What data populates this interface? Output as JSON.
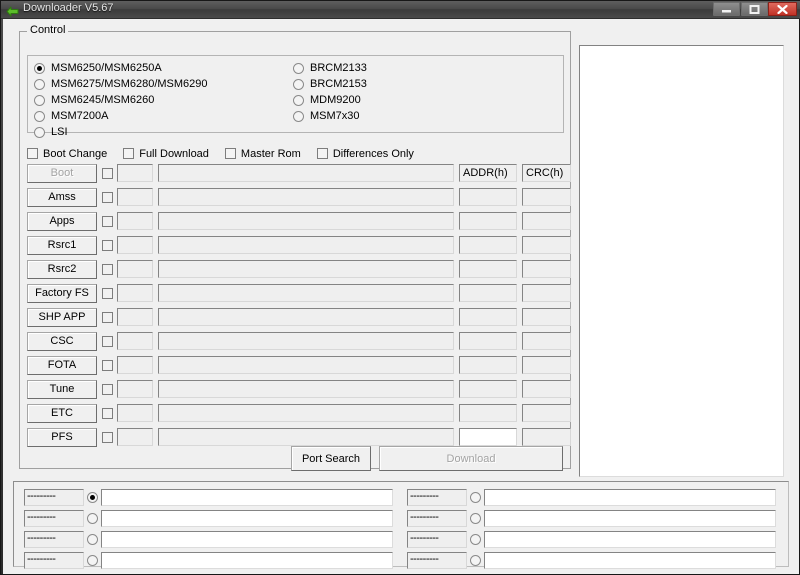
{
  "window": {
    "title": "Downloader V5.67",
    "icon": "green-left-arrow-icon",
    "minimize_label": "–",
    "maximize_label": "□",
    "close_label": "✕",
    "accent_close": "#c03226",
    "face_color": "#f0f0f0"
  },
  "control_group": {
    "legend": "Control",
    "chips": {
      "left": [
        {
          "label": "MSM6250/MSM6250A",
          "selected": true
        },
        {
          "label": "MSM6275/MSM6280/MSM6290",
          "selected": false
        },
        {
          "label": "MSM6245/MSM6260",
          "selected": false
        },
        {
          "label": "MSM7200A",
          "selected": false
        },
        {
          "label": "LSI",
          "selected": false
        }
      ],
      "right": [
        {
          "label": "BRCM2133",
          "selected": false
        },
        {
          "label": "BRCM2153",
          "selected": false
        },
        {
          "label": "MDM9200",
          "selected": false
        },
        {
          "label": "MSM7x30",
          "selected": false
        }
      ]
    },
    "options": [
      {
        "label": "Boot Change",
        "checked": false
      },
      {
        "label": "Full Download",
        "checked": false
      },
      {
        "label": "Master Rom",
        "checked": false
      },
      {
        "label": "Differences Only",
        "checked": false
      }
    ],
    "column_headers": {
      "addr": "ADDR(h)",
      "crc": "CRC(h)"
    },
    "rows": [
      {
        "button": "Boot",
        "enabled": false,
        "checked": false,
        "size": "",
        "path": "",
        "addr": "ADDR(h)",
        "crc": "CRC(h)",
        "addr_white": false
      },
      {
        "button": "Amss",
        "enabled": true,
        "checked": false,
        "size": "",
        "path": "",
        "addr": "",
        "crc": "",
        "addr_white": false
      },
      {
        "button": "Apps",
        "enabled": true,
        "checked": false,
        "size": "",
        "path": "",
        "addr": "",
        "crc": "",
        "addr_white": false
      },
      {
        "button": "Rsrc1",
        "enabled": true,
        "checked": false,
        "size": "",
        "path": "",
        "addr": "",
        "crc": "",
        "addr_white": false
      },
      {
        "button": "Rsrc2",
        "enabled": true,
        "checked": false,
        "size": "",
        "path": "",
        "addr": "",
        "crc": "",
        "addr_white": false
      },
      {
        "button": "Factory FS",
        "enabled": true,
        "checked": false,
        "size": "",
        "path": "",
        "addr": "",
        "crc": "",
        "addr_white": false
      },
      {
        "button": "SHP APP",
        "enabled": true,
        "checked": false,
        "size": "",
        "path": "",
        "addr": "",
        "crc": "",
        "addr_white": false
      },
      {
        "button": "CSC",
        "enabled": true,
        "checked": false,
        "size": "",
        "path": "",
        "addr": "",
        "crc": "",
        "addr_white": false
      },
      {
        "button": "FOTA",
        "enabled": true,
        "checked": false,
        "size": "",
        "path": "",
        "addr": "",
        "crc": "",
        "addr_white": false
      },
      {
        "button": "Tune",
        "enabled": true,
        "checked": false,
        "size": "",
        "path": "",
        "addr": "",
        "crc": "",
        "addr_white": false
      },
      {
        "button": "ETC",
        "enabled": true,
        "checked": false,
        "size": "",
        "path": "",
        "addr": "",
        "crc": "",
        "addr_white": false
      },
      {
        "button": "PFS",
        "enabled": true,
        "checked": false,
        "size": "",
        "path": "",
        "addr": "",
        "crc": "",
        "addr_white": true
      }
    ],
    "actions": {
      "port_search": {
        "label": "Port Search",
        "enabled": true
      },
      "download": {
        "label": "Download",
        "enabled": false
      }
    }
  },
  "log_panel": {
    "text": ""
  },
  "ports": {
    "left": [
      {
        "tag": "---------",
        "selected": true,
        "value": ""
      },
      {
        "tag": "---------",
        "selected": false,
        "value": ""
      },
      {
        "tag": "---------",
        "selected": false,
        "value": ""
      },
      {
        "tag": "---------",
        "selected": false,
        "value": ""
      }
    ],
    "right": [
      {
        "tag": "---------",
        "selected": false,
        "value": ""
      },
      {
        "tag": "---------",
        "selected": false,
        "value": ""
      },
      {
        "tag": "---------",
        "selected": false,
        "value": ""
      },
      {
        "tag": "---------",
        "selected": false,
        "value": ""
      }
    ]
  }
}
